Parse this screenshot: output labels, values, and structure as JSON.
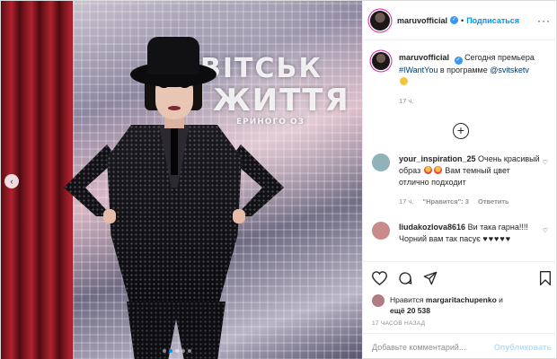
{
  "post": {
    "username": "maruvofficial",
    "follow_label": "Подписаться",
    "caption_user": "maruvofficial",
    "caption_text": "Сегодня премьера",
    "caption_hashtag": "#IWantYou",
    "caption_mid": "в программе",
    "caption_mention": "@svitsketv",
    "caption_time": "17 ч."
  },
  "media": {
    "sign_line1": "ВІТСЬК",
    "sign_line2": "ЖИТТЯ",
    "sign_line3": "ЕРИНОГО ОЗ"
  },
  "comments": [
    {
      "user": "your_inspiration_25",
      "text_a": "Очень красивый образ",
      "text_b": "Вам темный цвет отлично подходит",
      "time": "17 ч.",
      "likes": "\"Нравится\": 3",
      "reply": "Ответить",
      "avatar_color": "#8fb3b9"
    },
    {
      "user": "liudakozlova8616",
      "text": "Ви така гарна!!!! Чорний вам так пасує",
      "hearts": "♥♥♥♥♥",
      "avatar_color": "#c98a8a"
    }
  ],
  "likes": {
    "prefix": "Нравится",
    "user": "margaritachupenko",
    "suffix": "и",
    "more": "ещё 20 538"
  },
  "timestamp": "17 ЧАСОВ НАЗАД",
  "composer": {
    "placeholder": "Добавьте комментарий...",
    "post_label": "Опубликовать"
  },
  "colors": {
    "accent": "#0095f6",
    "link": "#00376b",
    "muted": "#8e8e8e",
    "post_disabled": "#b2dffc"
  },
  "icons": {
    "more": "more-icon",
    "like": "heart-icon",
    "comment": "comment-icon",
    "share": "share-icon",
    "save": "bookmark-icon",
    "add_comment": "plus-circle-icon",
    "prev": "chevron-left-icon"
  }
}
